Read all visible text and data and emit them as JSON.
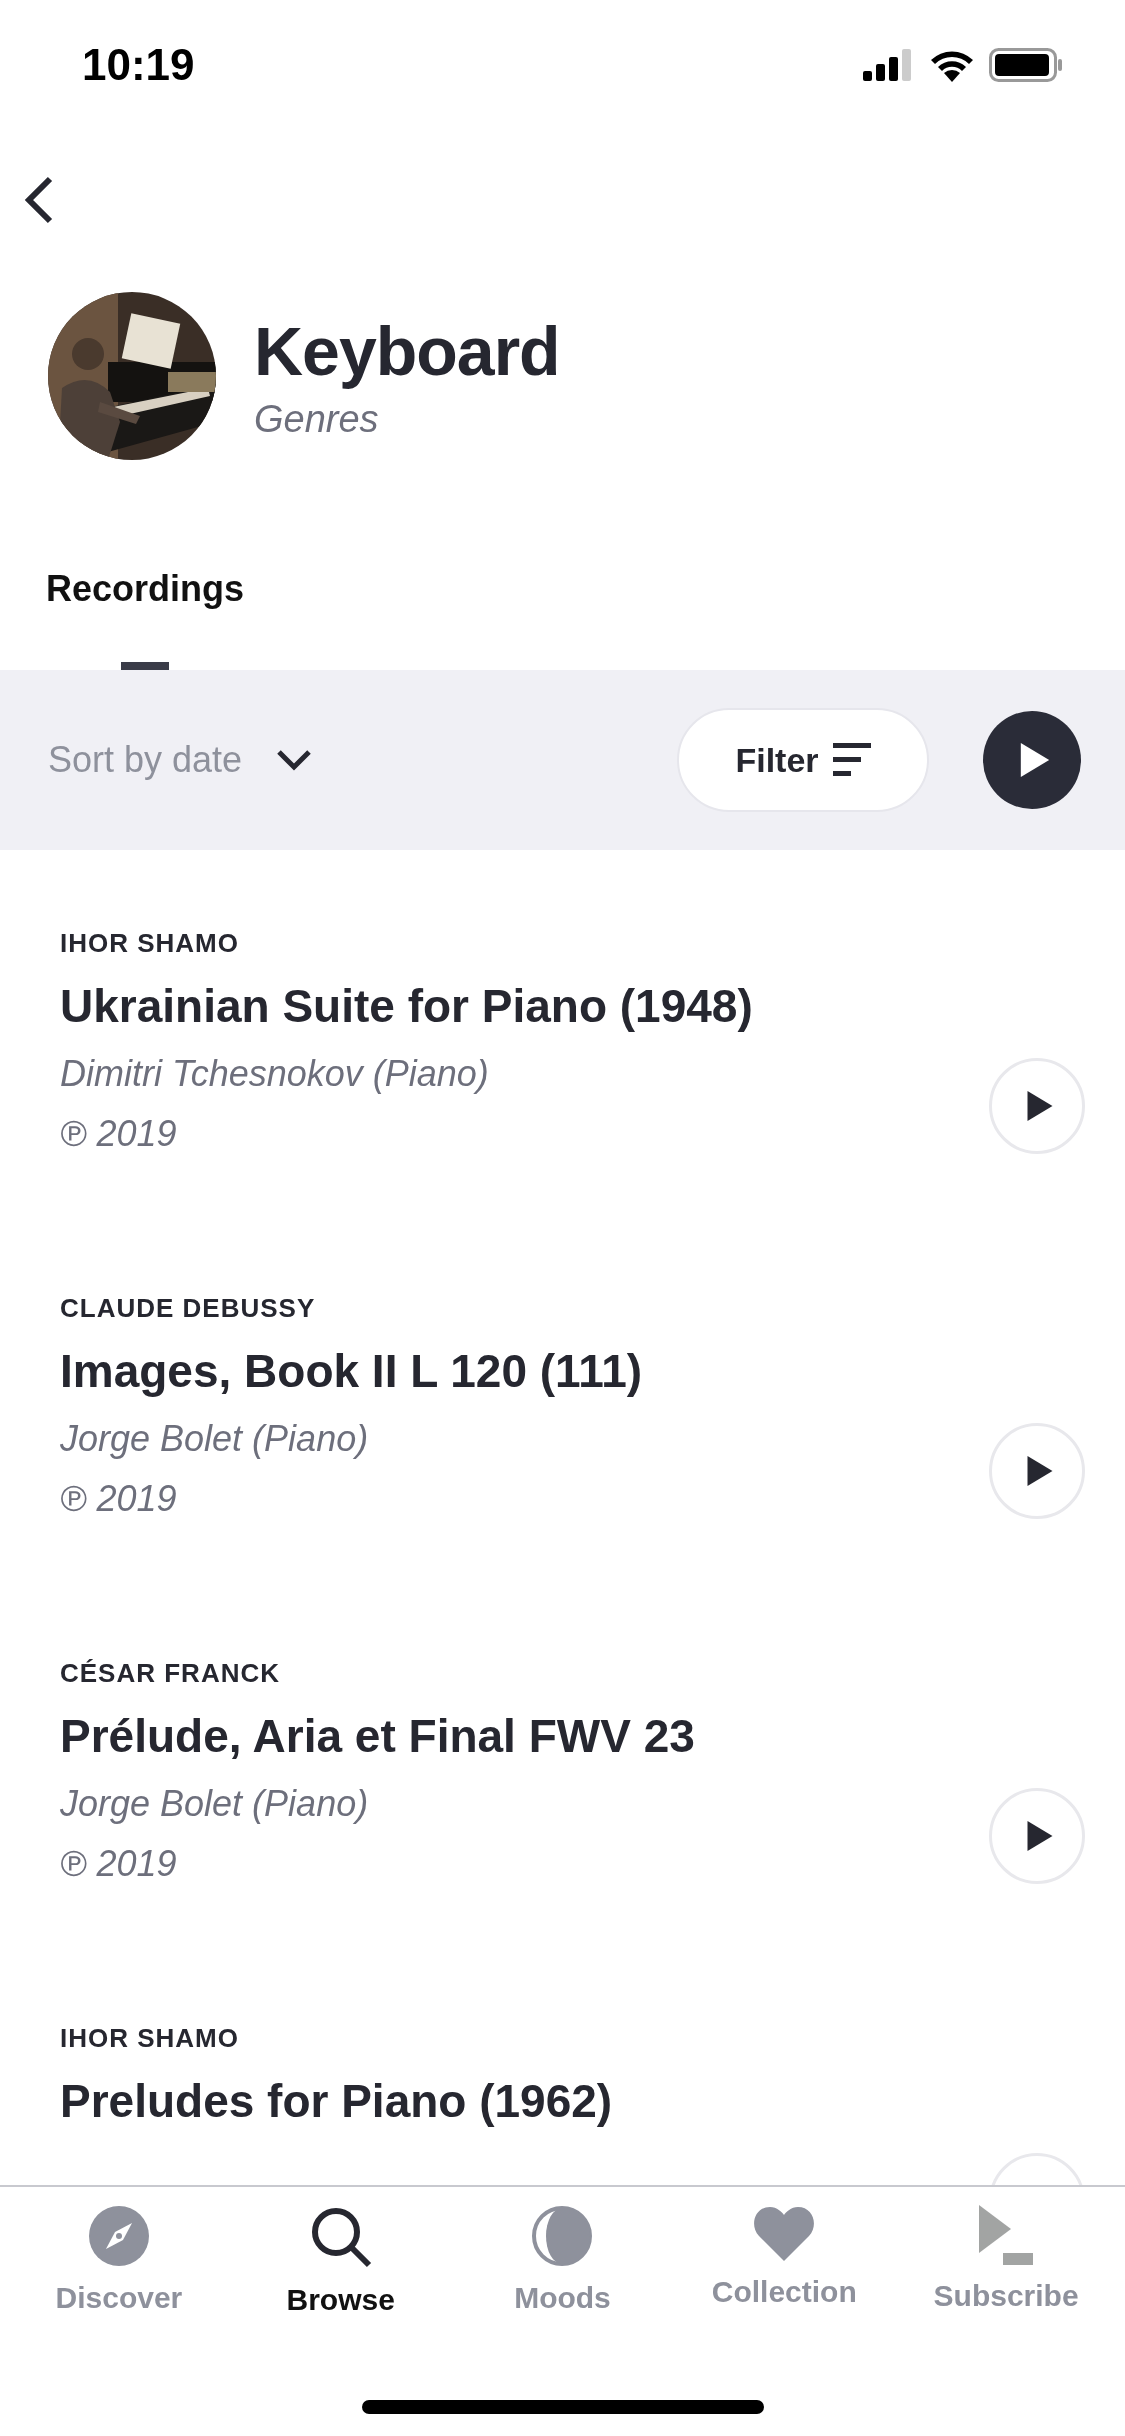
{
  "status_bar": {
    "time": "10:19"
  },
  "header": {
    "title": "Keyboard",
    "subtitle": "Genres"
  },
  "tabs": [
    {
      "label": "Recordings",
      "selected": true
    }
  ],
  "toolbar": {
    "sort": "Sort by date",
    "filter": "Filter"
  },
  "recordings": [
    {
      "composer": "IHOR SHAMO",
      "title": "Ukrainian Suite for Piano (1948)",
      "performer": "Dimitri Tchesnokov (Piano)",
      "year": "℗ 2019"
    },
    {
      "composer": "CLAUDE DEBUSSY",
      "title": "Images, Book II L 120 (111)",
      "performer": "Jorge Bolet (Piano)",
      "year": "℗ 2019"
    },
    {
      "composer": "CÉSAR FRANCK",
      "title": "Prélude, Aria et Final FWV 23",
      "performer": "Jorge Bolet (Piano)",
      "year": "℗ 2019"
    },
    {
      "composer": "IHOR SHAMO",
      "title": "Preludes for Piano (1962)"
    }
  ],
  "tab_bar": [
    {
      "kind": "compass",
      "label": "Discover",
      "selected": false
    },
    {
      "kind": "search",
      "label": "Browse",
      "selected": true
    },
    {
      "kind": "moon",
      "label": "Moods",
      "selected": false
    },
    {
      "kind": "heart",
      "label": "Collection",
      "selected": false
    },
    {
      "kind": "subscribe",
      "label": "Subscribe",
      "selected": false
    }
  ]
}
